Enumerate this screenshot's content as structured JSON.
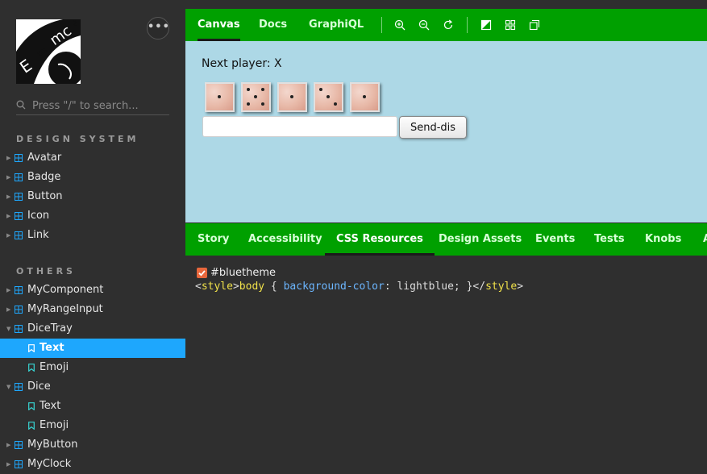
{
  "sidebar": {
    "search_placeholder": "Press \"/\" to search...",
    "menu_label": "•••",
    "sections": [
      {
        "title": "DESIGN SYSTEM",
        "items": [
          {
            "label": "Avatar"
          },
          {
            "label": "Badge"
          },
          {
            "label": "Button"
          },
          {
            "label": "Icon"
          },
          {
            "label": "Link"
          }
        ]
      },
      {
        "title": "OTHERS",
        "items": [
          {
            "label": "MyComponent"
          },
          {
            "label": "MyRangeInput"
          },
          {
            "label": "DiceTray",
            "expanded": true,
            "stories": [
              {
                "label": "Text",
                "selected": true
              },
              {
                "label": "Emoji"
              }
            ]
          },
          {
            "label": "Dice",
            "expanded": true,
            "stories": [
              {
                "label": "Text"
              },
              {
                "label": "Emoji"
              }
            ]
          },
          {
            "label": "MyButton"
          },
          {
            "label": "MyClock"
          }
        ]
      }
    ]
  },
  "toolbar": {
    "tabs": [
      "Canvas",
      "Docs",
      "GraphiQL"
    ],
    "active_tab": "Canvas",
    "tools": [
      "zoom-in-icon",
      "zoom-out-icon",
      "zoom-reset-icon",
      "background-icon",
      "grid-icon",
      "outline-icon"
    ]
  },
  "canvas": {
    "next_player": "Next player: X",
    "dice_faces": [
      1,
      5,
      1,
      3,
      1
    ],
    "input_value": "",
    "send_label": "Send-dis"
  },
  "addons": {
    "tabs": [
      "Story",
      "Accessibility",
      "CSS Resources",
      "Design Assets",
      "Events",
      "Tests",
      "Knobs",
      "A"
    ],
    "active_tab": "CSS Resources",
    "css_resource": {
      "checked": true,
      "name": "#bluetheme",
      "code": {
        "open_lt": "<",
        "open_tag": "style",
        "open_gt": ">",
        "selector": "body",
        "brace_open": " { ",
        "property": "background-color",
        "value": ": lightblue; }",
        "close_lt": "</",
        "close_tag": "style",
        "close_gt": ">"
      }
    }
  },
  "colors": {
    "accent": "#1ea7fd",
    "toolbar": "#00a000",
    "canvas_bg": "#add8e6",
    "sidebar_bg": "#2f2f2f"
  }
}
